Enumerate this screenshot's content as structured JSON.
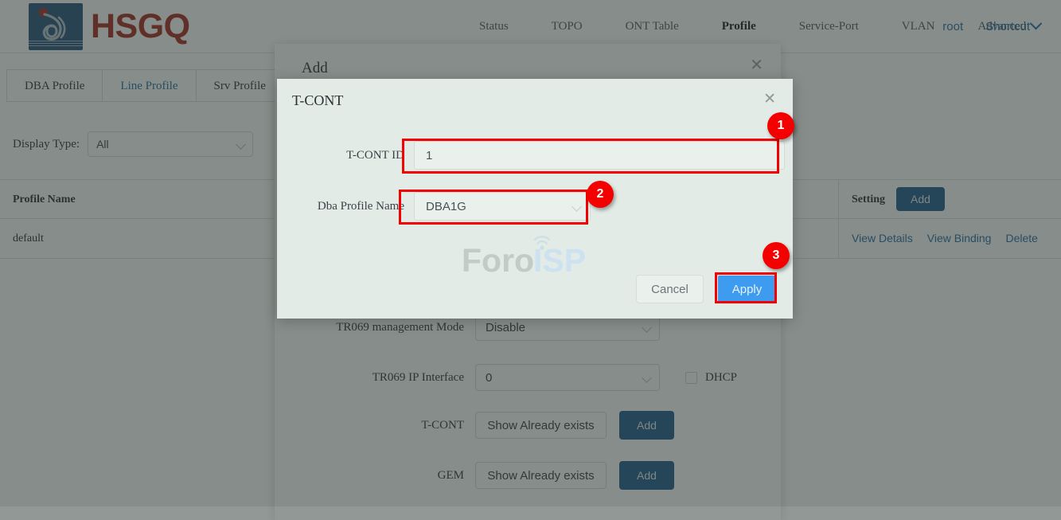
{
  "header": {
    "logo_text": "HSGQ",
    "logo_icon": "hsgq-flame-logo",
    "nav": [
      {
        "label": "Status",
        "active": false
      },
      {
        "label": "TOPO",
        "active": false
      },
      {
        "label": "ONT Table",
        "active": false
      },
      {
        "label": "Profile",
        "active": true
      },
      {
        "label": "Service-Port",
        "active": false
      },
      {
        "label": "VLAN",
        "active": false
      },
      {
        "label": "Advanced",
        "active": false
      }
    ],
    "user": "root",
    "shortcut": "Shortcut",
    "shortcut_icon": "chevron-down-icon"
  },
  "tabs": [
    {
      "label": "DBA Profile",
      "active": false
    },
    {
      "label": "Line Profile",
      "active": true
    },
    {
      "label": "Srv Profile",
      "active": false
    }
  ],
  "filter": {
    "label": "Display Type:",
    "value": "All",
    "caret_icon": "chevron-down-icon"
  },
  "table": {
    "columns": [
      "Profile Name",
      "",
      "",
      "",
      "Setting"
    ],
    "header_setting_label": "Setting",
    "header_add_label": "Add",
    "rows": [
      {
        "profile_name": "default",
        "actions": [
          "View Details",
          "View Binding",
          "Delete"
        ]
      }
    ]
  },
  "add_dialog": {
    "title": "Add",
    "close_icon": "close-icon",
    "fields": [
      {
        "label": "TR069 management Mode",
        "value": "Disable",
        "type": "select"
      },
      {
        "label": "TR069 IP Interface",
        "value": "0",
        "type": "select"
      }
    ],
    "dhcp_label": "DHCP",
    "tcont_label": "T-CONT",
    "gem_label": "GEM",
    "show_exists_label": "Show Already exists",
    "add_label": "Add"
  },
  "tcont_modal": {
    "title": "T-CONT",
    "close_icon": "close-icon",
    "tcont_id_label": "T-CONT ID",
    "tcont_id_value": "1",
    "dba_profile_label": "Dba Profile Name",
    "dba_profile_value": "DBA1G",
    "dba_caret_icon": "chevron-down-icon",
    "cancel_label": "Cancel",
    "apply_label": "Apply",
    "watermark_left": "Foro",
    "watermark_right": "ISP"
  },
  "annotations": [
    {
      "number": "1",
      "target": "tcont-id-input"
    },
    {
      "number": "2",
      "target": "dba-profile-select"
    },
    {
      "number": "3",
      "target": "apply-button"
    }
  ],
  "colors": {
    "accent_blue": "#2e6da4",
    "apply_blue": "#3d9bf0",
    "add_button_blue": "#245c8d",
    "brand_red": "#a62b20",
    "annotation_red": "#f40000",
    "modal_bg": "#e2ebe5"
  }
}
